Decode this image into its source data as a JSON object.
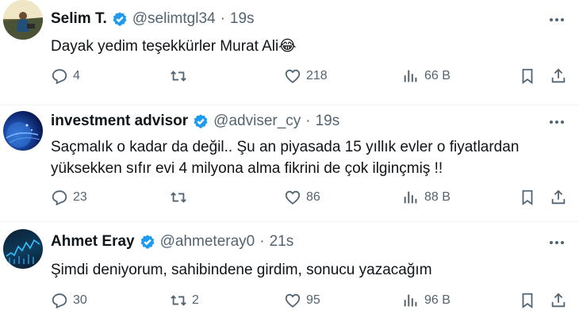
{
  "tweets": [
    {
      "name": "Selim T.",
      "handle": "@selimtgl34",
      "sep": "·",
      "time": "19s",
      "text": "Dayak yedim teşekkürler Murat Ali😂",
      "replies": "4",
      "retweets": "",
      "likes": "218",
      "views": "66 B",
      "avatar_icon": "profile-photo-person-landscape"
    },
    {
      "name": "investment advisor",
      "handle": "@adviser_cy",
      "sep": "·",
      "time": "19s",
      "text": "Saçmalık o kadar da değil.. Şu an piyasada 15 yıllık evler o fiyatlardan yüksekken sıfır evi 4 milyona alma fikrini de çok ilginçmiş !!",
      "replies": "23",
      "retweets": "",
      "likes": "86",
      "views": "88 B",
      "avatar_icon": "profile-photo-blue-globe"
    },
    {
      "name": "Ahmet Eray",
      "handle": "@ahmeteray0",
      "sep": "·",
      "time": "21s",
      "text": "Şimdi deniyorum, sahibindene girdim, sonucu yazacağım",
      "replies": "30",
      "retweets": "2",
      "likes": "95",
      "views": "96 B",
      "avatar_icon": "profile-photo-stock-chart"
    }
  ],
  "colors": {
    "text": "#0f1419",
    "secondary": "#536471",
    "verified": "#1d9bf0",
    "divider": "#eff3f4"
  },
  "icons": [
    "verified-badge-icon",
    "more-icon",
    "reply-icon",
    "retweet-icon",
    "like-icon",
    "views-icon",
    "bookmark-icon",
    "share-icon"
  ]
}
